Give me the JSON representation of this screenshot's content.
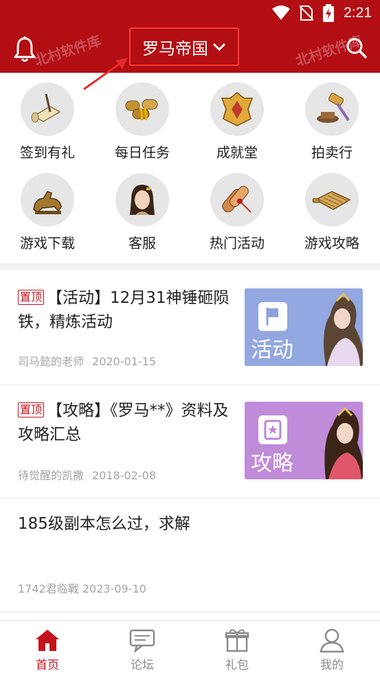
{
  "status_bar": {
    "time": "2:21"
  },
  "header": {
    "region_label": "罗马帝国",
    "watermark_left": "北村软件库",
    "watermark_right": "北村软件库",
    "accent_color": "#b30e14"
  },
  "grid": {
    "items": [
      {
        "label": "签到有礼",
        "icon": "scroll-quill-icon"
      },
      {
        "label": "每日任务",
        "icon": "bamboo-scrolls-icon"
      },
      {
        "label": "成就堂",
        "icon": "golden-crest-icon"
      },
      {
        "label": "拍卖行",
        "icon": "auction-hammer-icon"
      },
      {
        "label": "游戏下载",
        "icon": "bronze-beast-icon"
      },
      {
        "label": "客服",
        "icon": "support-girl-avatar"
      },
      {
        "label": "热门活动",
        "icon": "sealed-scroll-icon"
      },
      {
        "label": "游戏攻略",
        "icon": "bamboo-book-icon"
      }
    ]
  },
  "posts": [
    {
      "pin": "置顶",
      "title": "【活动】12月31神锤砸陨铁，精炼活动",
      "author": "司马懿的老师",
      "date": "2020-01-15",
      "thumb_label": "活动",
      "thumb_color": "#8da3dc"
    },
    {
      "pin": "置顶",
      "title": "【攻略】《罗马**》资料及攻略汇总",
      "author": "待觉醒的凯撒",
      "date": "2018-02-08",
      "thumb_label": "攻略",
      "thumb_color": "#bb86d6"
    },
    {
      "title": "185级副本怎么过，求解",
      "author": "1742君临戰",
      "date": "2023-09-10"
    }
  ],
  "bottom_nav": {
    "items": [
      {
        "label": "首页",
        "icon": "home-icon",
        "active": true
      },
      {
        "label": "论坛",
        "icon": "chat-icon",
        "active": false
      },
      {
        "label": "礼包",
        "icon": "gift-icon",
        "active": false
      },
      {
        "label": "我的",
        "icon": "user-icon",
        "active": false
      }
    ]
  }
}
